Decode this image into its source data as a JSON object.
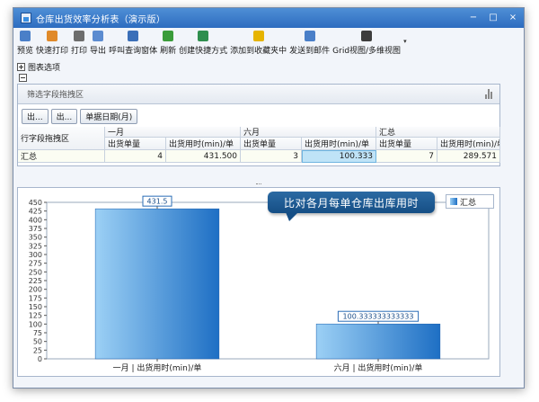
{
  "window": {
    "title": "仓库出货效率分析表（演示版）"
  },
  "window_controls": {
    "minimize": "−",
    "maximize": "□",
    "close": "×"
  },
  "toolbar": {
    "items": [
      {
        "label": "预览",
        "icon": "preview-icon",
        "color": "#4a7fc8"
      },
      {
        "label": "快速打印",
        "icon": "quick-print-icon",
        "color": "#e08a2a"
      },
      {
        "label": "打印",
        "icon": "printer-icon",
        "color": "#6d6d6d"
      },
      {
        "label": "导出",
        "icon": "export-icon",
        "color": "#5b8bd0"
      },
      {
        "label": "呼叫查询窗体",
        "icon": "query-window-icon",
        "color": "#3b6fb8"
      },
      {
        "label": "刷新",
        "icon": "refresh-icon",
        "color": "#3a9c3a"
      },
      {
        "label": "创建快捷方式",
        "icon": "shortcut-icon",
        "color": "#2f8f4e"
      },
      {
        "label": "添加到收藏夹中",
        "icon": "favorite-star-icon",
        "color": "#e6b400"
      },
      {
        "label": "发送到邮件",
        "icon": "mail-icon",
        "color": "#4a7fc8"
      },
      {
        "label": "Grid视图/多维视图",
        "icon": "grid-view-icon",
        "color": "#3d3d3d"
      }
    ]
  },
  "chart_options_label": "图表选项",
  "pivot": {
    "filter_area_label": "筛选字段拖拽区",
    "field_buttons": [
      "出...",
      "出...",
      "单据日期(月)"
    ],
    "row_area_label": "行字段拖拽区",
    "column_groups": [
      "一月",
      "六月",
      "汇总"
    ],
    "measure_headers": [
      "出货单量",
      "出货用时(min)/单",
      "出货单量",
      "出货用时(min)/单",
      "出货单量",
      "出货用时(min)/单"
    ],
    "rows": [
      {
        "label": "汇总",
        "values": [
          "4",
          "431.500",
          "3",
          "100.333",
          "7",
          "289.571"
        ]
      }
    ]
  },
  "callout_text": "比对各月每单仓库出库用时",
  "chart_data": {
    "type": "bar",
    "categories": [
      "一月 | 出货用时(min)/单",
      "六月 | 出货用时(min)/单"
    ],
    "series": [
      {
        "name": "汇总",
        "values": [
          431.5,
          100.333333333333
        ]
      }
    ],
    "data_labels": [
      "431.5",
      "100.333333333333"
    ],
    "ylim": [
      0,
      450
    ],
    "yticks": [
      0,
      25,
      50,
      75,
      100,
      125,
      150,
      175,
      200,
      225,
      250,
      275,
      300,
      325,
      350,
      375,
      400,
      425,
      450
    ],
    "grid": false,
    "legend": "top-right",
    "colors": {
      "bar_light": "#9cd0f5",
      "bar_dark": "#1e6fc4"
    }
  }
}
